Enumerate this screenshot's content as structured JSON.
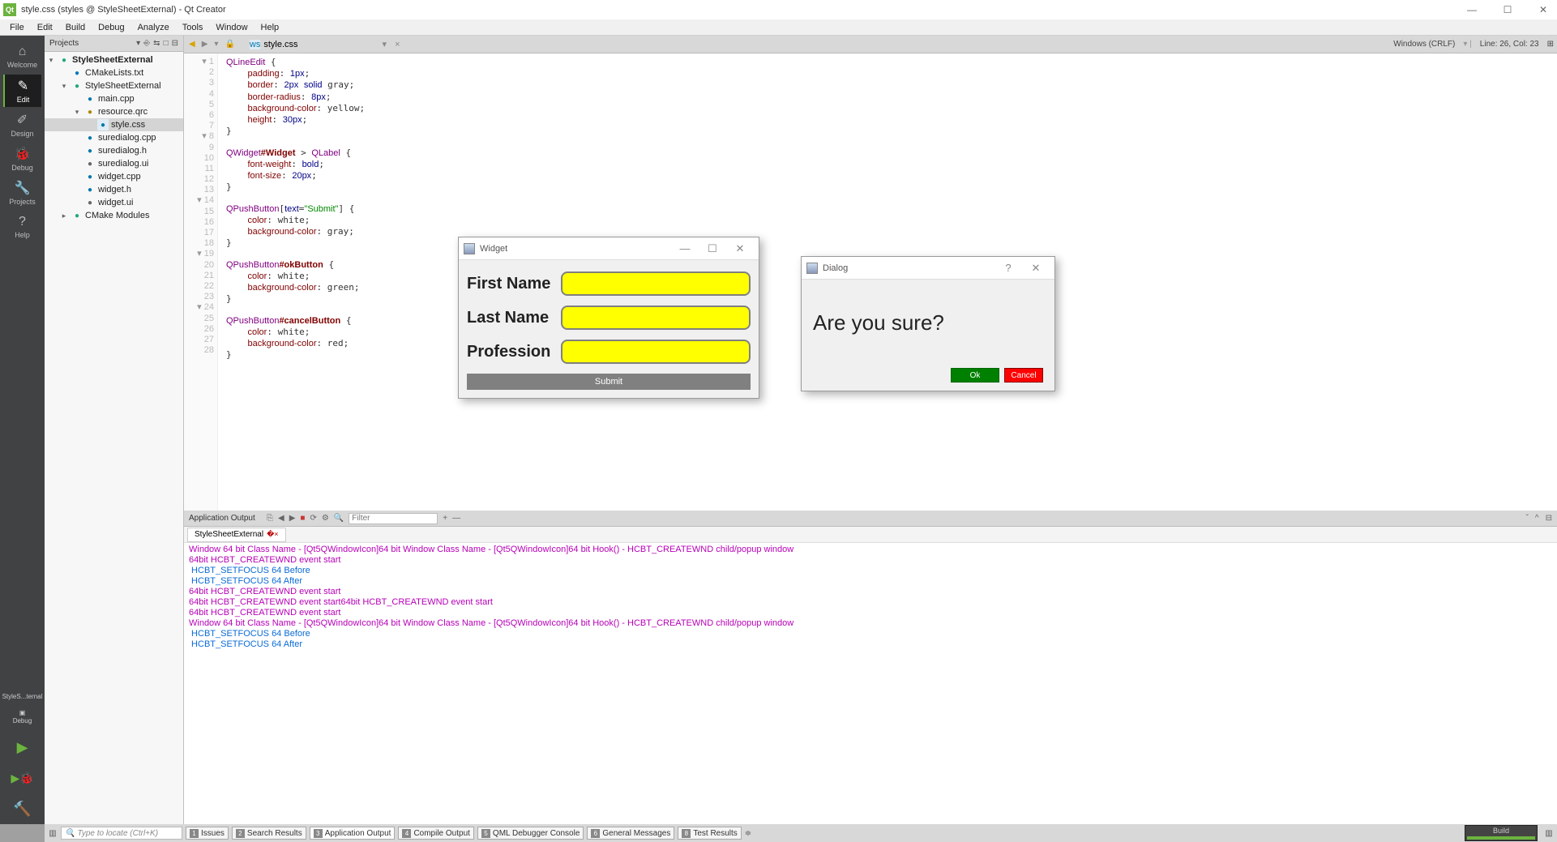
{
  "window": {
    "title": "style.css (styles @ StyleSheetExternal) - Qt Creator"
  },
  "menubar": [
    "File",
    "Edit",
    "Build",
    "Debug",
    "Analyze",
    "Tools",
    "Window",
    "Help"
  ],
  "modes": [
    {
      "label": "Welcome",
      "icon": "⌂"
    },
    {
      "label": "Edit",
      "icon": "✎",
      "selected": true
    },
    {
      "label": "Design",
      "icon": "✐"
    },
    {
      "label": "Debug",
      "icon": "🐞"
    },
    {
      "label": "Projects",
      "icon": "🔧"
    },
    {
      "label": "Help",
      "icon": "?"
    }
  ],
  "kit": {
    "line1": "StyleS...ternal",
    "line2": "Debug"
  },
  "projects_header": {
    "title": "Projects",
    "icons": [
      "▾",
      "⎃",
      "⟳",
      "□",
      "⊟"
    ]
  },
  "tree": [
    {
      "d": 0,
      "tw": "▾",
      "ico": "ico-proj",
      "t": "StyleSheetExternal",
      "bold": true
    },
    {
      "d": 1,
      "tw": "",
      "ico": "ico-cmk",
      "t": "CMakeLists.txt"
    },
    {
      "d": 1,
      "tw": "▾",
      "ico": "ico-proj",
      "t": "StyleSheetExternal"
    },
    {
      "d": 2,
      "tw": "",
      "ico": "ico-cpp",
      "t": "main.cpp"
    },
    {
      "d": 2,
      "tw": "▾",
      "ico": "ico-rc",
      "t": "resource.qrc"
    },
    {
      "d": 3,
      "tw": "",
      "ico": "ico-css",
      "t": "style.css",
      "sel": true
    },
    {
      "d": 2,
      "tw": "",
      "ico": "ico-cpp",
      "t": "suredialog.cpp"
    },
    {
      "d": 2,
      "tw": "",
      "ico": "ico-h",
      "t": "suredialog.h"
    },
    {
      "d": 2,
      "tw": "",
      "ico": "ico-ui",
      "t": "suredialog.ui"
    },
    {
      "d": 2,
      "tw": "",
      "ico": "ico-cpp",
      "t": "widget.cpp"
    },
    {
      "d": 2,
      "tw": "",
      "ico": "ico-h",
      "t": "widget.h"
    },
    {
      "d": 2,
      "tw": "",
      "ico": "ico-ui",
      "t": "widget.ui"
    },
    {
      "d": 1,
      "tw": "▸",
      "ico": "ico-proj",
      "t": "CMake Modules"
    }
  ],
  "editor_tab": {
    "file": "style.css",
    "close": "×",
    "nav_back": "◀",
    "nav_fwd": "▶",
    "history": "▾",
    "lock": "🔒"
  },
  "editor_status": {
    "encoding": "Windows (CRLF)",
    "pos": "Line: 26, Col: 23",
    "split": "⊞"
  },
  "code_lines": 28,
  "app_output": {
    "header": "Application Output",
    "filter_placeholder": "Filter",
    "tab": "StyleSheetExternal",
    "lines": [
      {
        "c": "m",
        "t": "Window 64 bit Class Name - [Qt5QWindowIcon]64 bit Window Class Name - [Qt5QWindowIcon]64 bit Hook() - HCBT_CREATEWND child/popup window"
      },
      {
        "c": "m",
        "t": "64bit HCBT_CREATEWND event start"
      },
      {
        "c": "b",
        "t": " HCBT_SETFOCUS 64 Before"
      },
      {
        "c": "b",
        "t": " HCBT_SETFOCUS 64 After"
      },
      {
        "c": "m",
        "t": "64bit HCBT_CREATEWND event start"
      },
      {
        "c": "m",
        "t": "64bit HCBT_CREATEWND event start64bit HCBT_CREATEWND event start"
      },
      {
        "c": "m",
        "t": "64bit HCBT_CREATEWND event start"
      },
      {
        "c": "m",
        "t": "Window 64 bit Class Name - [Qt5QWindowIcon]64 bit Window Class Name - [Qt5QWindowIcon]64 bit Hook() - HCBT_CREATEWND child/popup window"
      },
      {
        "c": "b",
        "t": " HCBT_SETFOCUS 64 Before"
      },
      {
        "c": "b",
        "t": " HCBT_SETFOCUS 64 After"
      }
    ]
  },
  "status_tabs": [
    {
      "n": "1",
      "t": "Issues"
    },
    {
      "n": "2",
      "t": "Search Results"
    },
    {
      "n": "3",
      "t": "Application Output",
      "active": true
    },
    {
      "n": "4",
      "t": "Compile Output"
    },
    {
      "n": "5",
      "t": "QML Debugger Console"
    },
    {
      "n": "6",
      "t": "General Messages"
    },
    {
      "n": "8",
      "t": "Test Results"
    }
  ],
  "locator_placeholder": "Type to locate (Ctrl+K)",
  "build_label": "Build",
  "widget_win": {
    "title": "Widget",
    "fields": [
      {
        "label": "First Name"
      },
      {
        "label": "Last Name"
      },
      {
        "label": "Profession"
      }
    ],
    "submit": "Submit"
  },
  "dialog_win": {
    "title": "Dialog",
    "question": "Are you sure?",
    "ok": "Ok",
    "cancel": "Cancel"
  }
}
